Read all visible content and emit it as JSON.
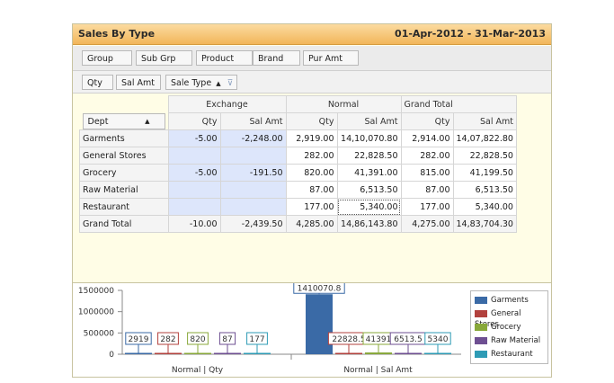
{
  "header": {
    "title": "Sales By Type",
    "date_range": "01-Apr-2012 - 31-Mar-2013"
  },
  "field_bar": {
    "row1": [
      "Group",
      "Sub Grp",
      "Product",
      "Brand",
      "Pur Amt"
    ],
    "row2": [
      "Qty",
      "Sal Amt"
    ],
    "column_field": "Sale Type",
    "column_sort_glyph": "▲",
    "filter_glyph": "⊽"
  },
  "pivot": {
    "row_header": "Dept",
    "row_sort_glyph": "▲",
    "column_groups": [
      "Exchange",
      "Normal",
      "Grand Total"
    ],
    "measure_labels": [
      "Qty",
      "Sal Amt"
    ],
    "rows": [
      {
        "dept": "Garments",
        "values": [
          "-5.00",
          "-2,248.00",
          "2,919.00",
          "14,10,070.80",
          "2,914.00",
          "14,07,822.80"
        ]
      },
      {
        "dept": "General Stores",
        "values": [
          "",
          "",
          "282.00",
          "22,828.50",
          "282.00",
          "22,828.50"
        ]
      },
      {
        "dept": "Grocery",
        "values": [
          "-5.00",
          "-191.50",
          "820.00",
          "41,391.00",
          "815.00",
          "41,199.50"
        ]
      },
      {
        "dept": "Raw Material",
        "values": [
          "",
          "",
          "87.00",
          "6,513.50",
          "87.00",
          "6,513.50"
        ]
      },
      {
        "dept": "Restaurant",
        "values": [
          "",
          "",
          "177.00",
          "5,340.00",
          "177.00",
          "5,340.00"
        ]
      }
    ],
    "grand_total": {
      "label": "Grand Total",
      "values": [
        "-10.00",
        "-2,439.50",
        "4,285.00",
        "14,86,143.80",
        "4,275.00",
        "14,83,704.30"
      ]
    }
  },
  "chart_data": {
    "type": "bar",
    "categories": [
      "Normal | Qty",
      "Normal | Sal Amt"
    ],
    "series": [
      {
        "name": "Garments",
        "color": "#3a6aa6",
        "values": [
          2919,
          1410070.8
        ]
      },
      {
        "name": "General Stores",
        "color": "#b2413d",
        "values": [
          282,
          22828.5
        ]
      },
      {
        "name": "Grocery",
        "color": "#88a83a",
        "values": [
          820,
          41391
        ]
      },
      {
        "name": "Raw Material",
        "color": "#6e4f92",
        "values": [
          87,
          6513.5
        ]
      },
      {
        "name": "Restaurant",
        "color": "#2e9bb5",
        "values": [
          177,
          5340
        ]
      }
    ],
    "data_labels": [
      [
        "2919",
        "282",
        "820",
        "87",
        "177"
      ],
      [
        "1410070.8",
        "22828.5",
        "41391",
        "6513.5",
        "5340"
      ]
    ],
    "y_ticks": [
      "1500000",
      "1000000",
      "500000",
      "0"
    ],
    "ylim": [
      0,
      1500000
    ],
    "legend_position": "right"
  }
}
